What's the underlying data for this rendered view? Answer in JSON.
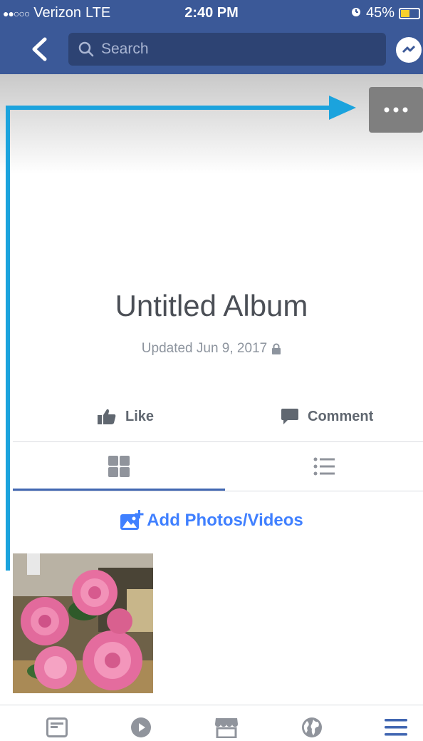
{
  "status_bar": {
    "signal": "●●○○○",
    "carrier": "Verizon",
    "network": "LTE",
    "time": "2:40 PM",
    "battery": "45%",
    "battery_level": 0.45
  },
  "nav": {
    "search_placeholder": "Search"
  },
  "album": {
    "title": "Untitled Album",
    "updated": "Updated Jun 9, 2017"
  },
  "actions": {
    "like_label": "Like",
    "comment_label": "Comment"
  },
  "add_photos_label": "Add Photos/Videos",
  "colors": {
    "nav_blue": "#3b5998",
    "annotation_arrow": "#1ba3dd",
    "link_blue": "#4080ff"
  },
  "bottom_bar": {
    "items": [
      "news-feed-icon",
      "video-icon",
      "marketplace-icon",
      "notifications-globe-icon",
      "menu-icon"
    ]
  }
}
